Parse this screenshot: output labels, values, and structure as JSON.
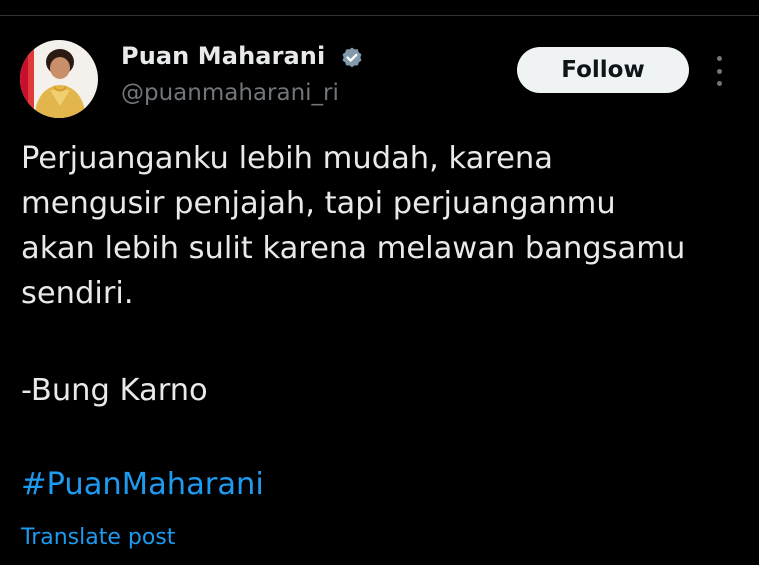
{
  "post": {
    "author": {
      "display_name": "Puan Maharani",
      "handle": "@puanmaharani_ri",
      "verified_icon": "verified-badge-icon",
      "avatar_icon": "avatar-photo"
    },
    "follow_label": "Follow",
    "more_icon": "more-options-icon",
    "text_lines": [
      "Perjuanganku lebih mudah, karena",
      "mengusir penjajah, tapi perjuanganmu",
      "akan lebih sulit karena melawan bangsamu",
      "sendiri."
    ],
    "signature": "-Bung Karno",
    "hashtag": "#PuanMaharani",
    "translate_label": "Translate post"
  },
  "colors": {
    "background": "#000000",
    "primary_text": "#e7e9ea",
    "secondary_text": "#71767b",
    "accent": "#1d9bf0",
    "follow_button_bg": "#eff3f4",
    "follow_button_text": "#0f1419",
    "divider": "#2f3336"
  }
}
